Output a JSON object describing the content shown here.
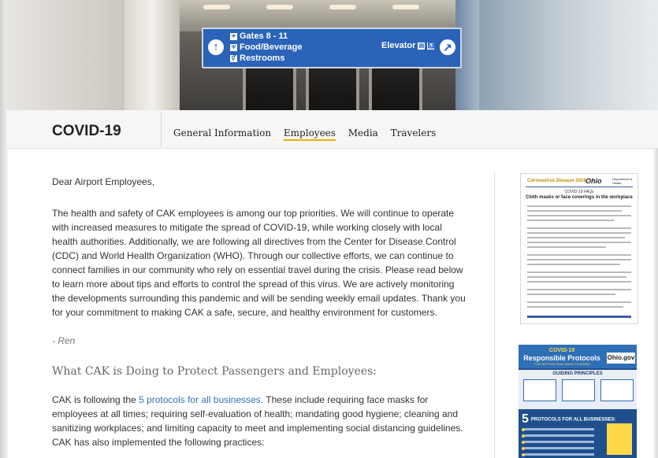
{
  "hero": {
    "sign_lines": [
      "Gates 8 - 11",
      "Food/Beverage",
      "Restrooms"
    ],
    "sign_elevator": "Elevator"
  },
  "header": {
    "title": "COVID-19",
    "nav": [
      "General Information",
      "Employees",
      "Media",
      "Travelers"
    ],
    "active_nav": "Employees"
  },
  "content": {
    "greeting": "Dear Airport Employees,",
    "paragraph1": "The health and safety of CAK employees is among our top priorities. We will continue to operate with increased measures to mitigate the spread of COVID-19, while working closely with local health authorities. Additionally, we are following all directives from the Center for Disease Control (CDC) and World Health Organization (WHO). Through our collective efforts, we can continue to connect families in our community who rely on essential travel during the crisis. Please read below to learn more about tips and efforts to control the spread of this virus. We are actively monitoring the developments surrounding this pandemic and will be sending weekly email updates. Thank you for your commitment to making CAK a safe, secure, and healthy environment for customers.",
    "signature": "- Ren",
    "section_heading": "What CAK is Doing to Protect Passengers and Employees:",
    "paragraph2_before": "CAK is following the ",
    "paragraph2_link": "5 protocols for all businesses",
    "paragraph2_after": ". These include requiring face masks for employees at all times; requiring self-evaluation of health; mandating good hygiene; cleaning and sanitizing workplaces; and limiting capacity to meet and implementing social distancing guidelines. CAK has also implemented the following practices:"
  },
  "sidebar": {
    "doc1": {
      "header": "Coronavirus Disease 2019",
      "state": "Ohio",
      "dept": "Department of Health",
      "faq": "COVID-19 FAQs",
      "heading": "Cloth masks or face coverings in the workplace"
    },
    "doc2": {
      "line1": "COVID-19",
      "line2": "Responsible Protocols",
      "line3": "FOR GETTING OHIO BACK TO WORK",
      "site": "Ohio.gov",
      "principles": "GUIDING PRINCIPLES",
      "protocols": "PROTOCOLS FOR ALL BUSINESSES:",
      "protocol_count": "5"
    }
  }
}
